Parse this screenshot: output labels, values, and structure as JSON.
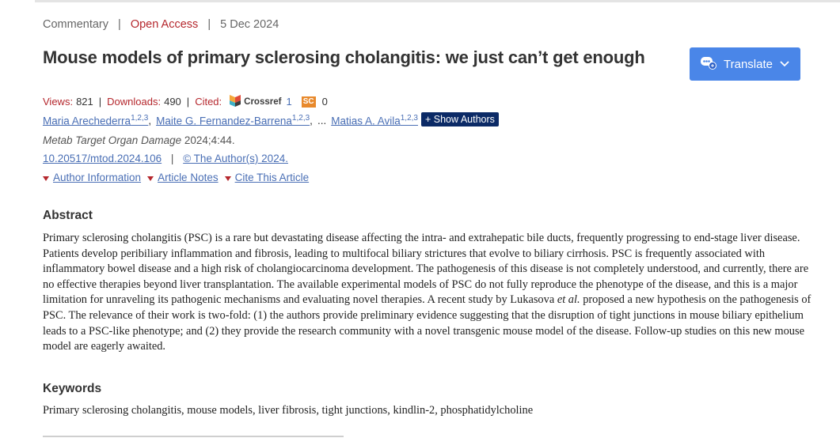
{
  "header": {
    "article_type": "Commentary",
    "access": "Open Access",
    "date": "5 Dec 2024",
    "title": "Mouse models of primary sclerosing cholangitis: we just can’t get enough"
  },
  "translate": {
    "label": "Translate"
  },
  "stats": {
    "views_label": "Views:",
    "views": "821",
    "downloads_label": "Downloads:",
    "downloads": "490",
    "cited_label": "Cited:",
    "crossref_logo_text": "Crossref",
    "crossref_count": "1",
    "sc_badge": "SC",
    "sc_count": "0"
  },
  "authors": [
    {
      "name": "Maria Arechederra",
      "aff": "1,2,3"
    },
    {
      "name": "Maite G. Fernandez-Barrena",
      "aff": "1,2,3"
    },
    {
      "name": "Matias A. Avila",
      "aff": "1,2,3"
    }
  ],
  "authors_ellipsis": "...",
  "show_authors_label": "+ Show Authors",
  "citation": {
    "journal": "Metab Target Organ Damage",
    "rest": " 2024;4:44."
  },
  "doi": {
    "doi": "10.20517/mtod.2024.106",
    "copyright": "© The Author(s) 2024."
  },
  "info_links": [
    "Author Information",
    "Article Notes",
    "Cite This Article"
  ],
  "abstract": {
    "heading": "Abstract",
    "text_before": "Primary sclerosing cholangitis (PSC) is a rare but devastating disease affecting the intra- and extrahepatic bile ducts, frequently progressing to end-stage liver disease. Patients develop peribiliary inflammation and fibrosis, leading to multifocal biliary strictures that evolve to biliary cirrhosis. PSC is frequently associated with inflammatory bowel disease and a high risk of cholangiocarcinoma development. The pathogenesis of this disease is not completely understood, and currently, there are no effective therapies beyond liver transplantation. The available experimental models of PSC do not fully reproduce the phenotype of the disease, and this is a major limitation for unraveling its pathogenic mechanisms and evaluating novel therapies. A recent study by Lukasova ",
    "text_italic": "et al.",
    "text_after": " proposed a new hypothesis on the pathogenesis of PSC. The relevance of their work is two-fold: (1) the authors provide preliminary evidence suggesting that the disruption of tight junctions in mouse biliary epithelium leads to a PSC-like phenotype; and (2) they provide the research community with a novel transgenic mouse model of the disease. Follow-up studies on this new mouse model are eagerly awaited."
  },
  "keywords": {
    "heading": "Keywords",
    "text": "Primary sclerosing cholangitis, mouse models, liver fibrosis, tight junctions, kindlin-2, phosphatidylcholine"
  },
  "colors": {
    "accent_red": "#b5272d",
    "link_blue": "#4a6fb5",
    "button_blue": "#4a86e8",
    "navy": "#0b2a66",
    "sc_orange": "#e8892c"
  }
}
